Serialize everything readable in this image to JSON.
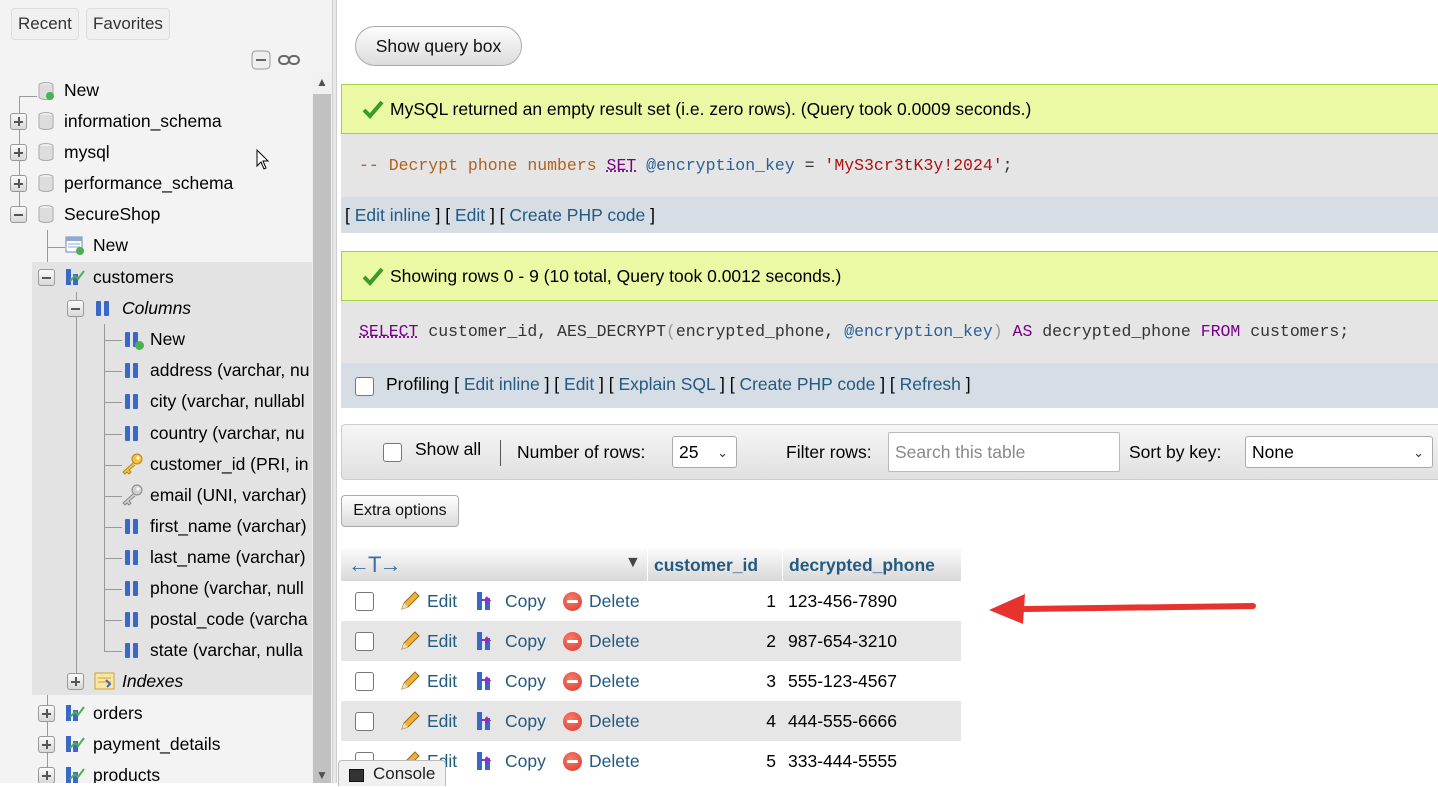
{
  "nav": {
    "tabs": [
      "Recent",
      "Favorites"
    ],
    "tree": {
      "new_root": "New",
      "databases": [
        "information_schema",
        "mysql",
        "performance_schema",
        "SecureShop"
      ],
      "secureshop": {
        "new": "New",
        "tables": {
          "customers": "customers",
          "columns_label": "Columns",
          "new_column": "New",
          "columns": [
            "address (varchar, nu",
            "city (varchar, nullabl",
            "country (varchar, nu",
            "customer_id (PRI, in",
            "email (UNI, varchar)",
            "first_name (varchar)",
            "last_name (varchar)",
            "phone (varchar, null",
            "postal_code (varcha",
            "state (varchar, nulla"
          ],
          "indexes_label": "Indexes",
          "other_tables": [
            "orders",
            "payment_details",
            "products"
          ]
        }
      }
    }
  },
  "main": {
    "show_query_box": "Show query box",
    "result1": {
      "message": "MySQL returned an empty result set (i.e. zero rows). (Query took 0.0009 seconds.)",
      "sql": {
        "comment": "-- Decrypt phone numbers",
        "set": "SET",
        "var": "@encryption_key",
        "eq": "=",
        "str": "'MyS3cr3tK3y!2024'",
        "end": ";"
      },
      "links": [
        "Edit inline",
        "Edit",
        "Create PHP code"
      ]
    },
    "result2": {
      "message": "Showing rows 0 - 9 (10 total, Query took 0.0012 seconds.)",
      "sql": {
        "select": "SELECT",
        "part1": "customer_id, AES_DECRYPT",
        "open": "(",
        "part2": "encrypted_phone, ",
        "var": "@encryption_key",
        "close": ")",
        "as": "AS",
        "part3": "decrypted_phone",
        "from": "FROM",
        "part4": "customers;"
      },
      "profiling": "Profiling",
      "links": [
        "Edit inline",
        "Edit",
        "Explain SQL",
        "Create PHP code",
        "Refresh"
      ]
    },
    "controls": {
      "show_all": "Show all",
      "num_rows_label": "Number of rows:",
      "num_rows_value": "25",
      "filter_label": "Filter rows:",
      "filter_placeholder": "Search this table",
      "sort_label": "Sort by key:",
      "sort_value": "None",
      "extra_options": "Extra options"
    },
    "table": {
      "columns": [
        "customer_id",
        "decrypted_phone"
      ],
      "actions": {
        "edit": "Edit",
        "copy": "Copy",
        "delete": "Delete"
      },
      "rows": [
        {
          "customer_id": "1",
          "decrypted_phone": "123-456-7890"
        },
        {
          "customer_id": "2",
          "decrypted_phone": "987-654-3210"
        },
        {
          "customer_id": "3",
          "decrypted_phone": "555-123-4567"
        },
        {
          "customer_id": "4",
          "decrypted_phone": "444-555-6666"
        },
        {
          "customer_id": "5",
          "decrypted_phone": "333-444-5555"
        }
      ]
    },
    "console": "Console"
  },
  "colors": {
    "link": "#235a81",
    "success_bg": "#ebf8a4",
    "annotation_arrow": "#e8322e"
  }
}
